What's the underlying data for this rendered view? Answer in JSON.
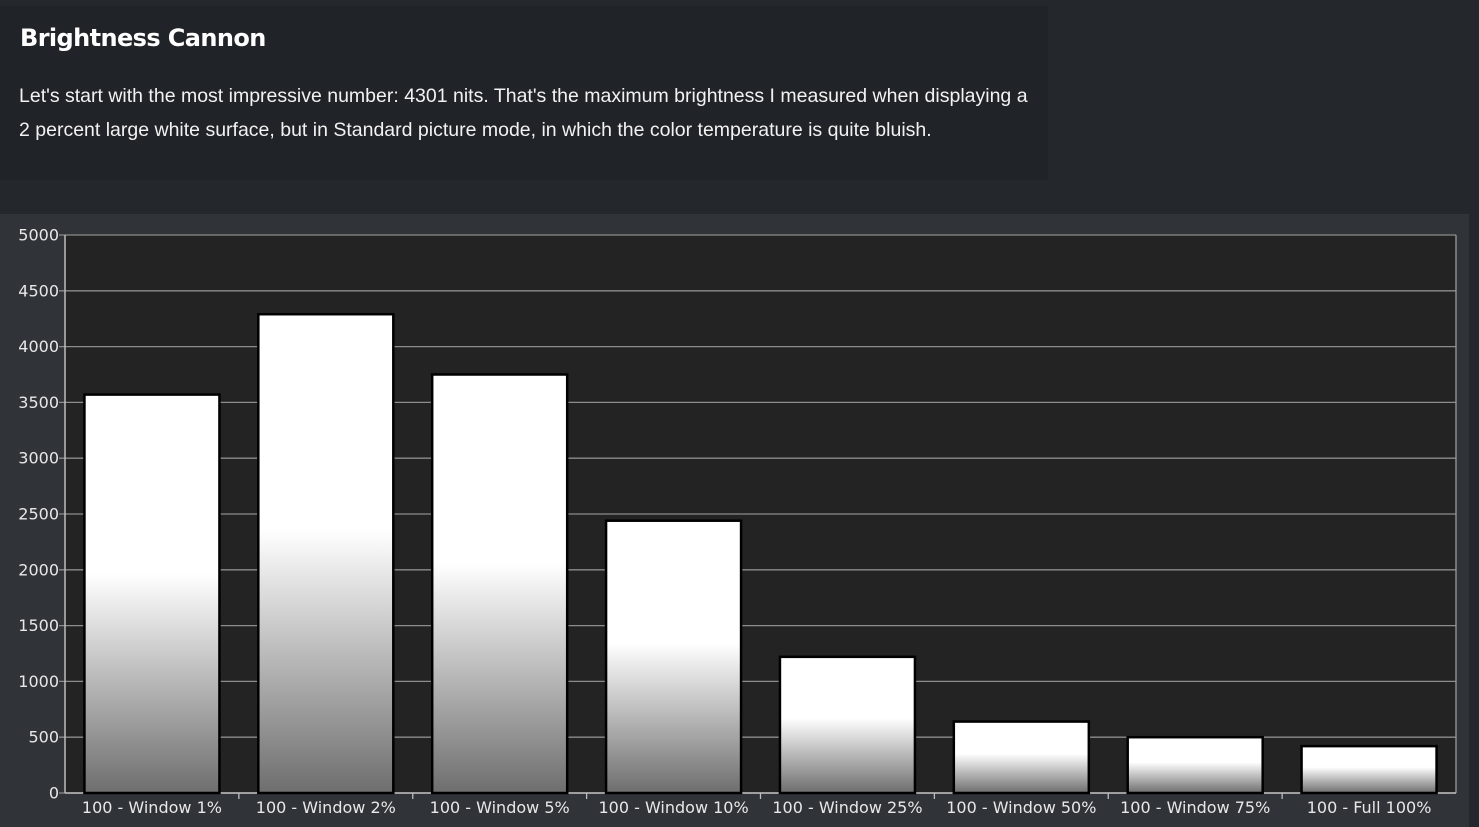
{
  "article": {
    "title": "Brightness Cannon",
    "body": "Let's start with the most impressive number: 4301 nits. That's the maximum brightness I measured when displaying a 2 percent large white surface, but in Standard picture mode, in which the color temperature is quite bluish."
  },
  "chart_data": {
    "type": "bar",
    "title": "",
    "xlabel": "",
    "ylabel": "",
    "categories": [
      "100 - Window  1%",
      "100 - Window  2%",
      "100 - Window  5%",
      "100 - Window 10%",
      "100 - Window 25%",
      "100 - Window 50%",
      "100 - Window 75%",
      "100 - Full  100%"
    ],
    "values": [
      3570,
      4290,
      3750,
      2440,
      1220,
      640,
      500,
      420
    ],
    "ylim": [
      0,
      5000
    ],
    "yticks": [
      0,
      500,
      1000,
      1500,
      2000,
      2500,
      3000,
      3500,
      4000,
      4500,
      5000
    ],
    "grid": true,
    "legend": "none",
    "colors": {
      "plot_background": "#232323",
      "panel_background": "#303338",
      "gridline": "#8c8c8c",
      "bar_top": "#ffffff",
      "bar_bottom": "#6e6e6e",
      "bar_outline": "#000000"
    }
  }
}
